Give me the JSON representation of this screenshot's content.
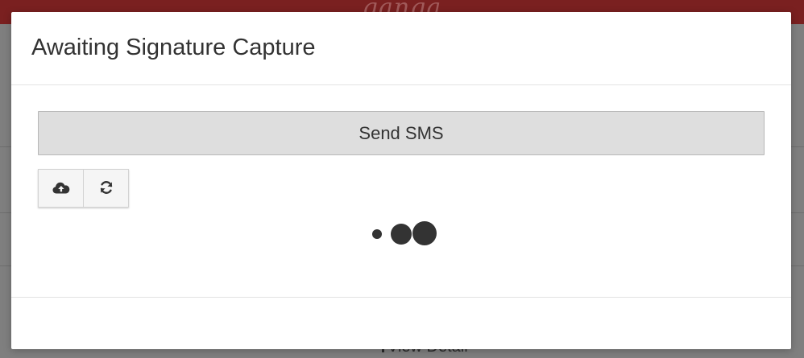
{
  "background": {
    "logo_text": "ganga",
    "link_label": "View Detail"
  },
  "modal": {
    "title": "Awaiting Signature Capture",
    "send_sms_label": "Send SMS",
    "icons": {
      "upload": "cloud-upload-icon",
      "refresh": "refresh-icon"
    },
    "loader": "loading-dots"
  },
  "colors": {
    "header_bar": "#7a2020",
    "text": "#333333",
    "button_bg": "#dedede",
    "button_border": "#b7b7b7",
    "icon_button_bg": "#f5f5f5"
  }
}
